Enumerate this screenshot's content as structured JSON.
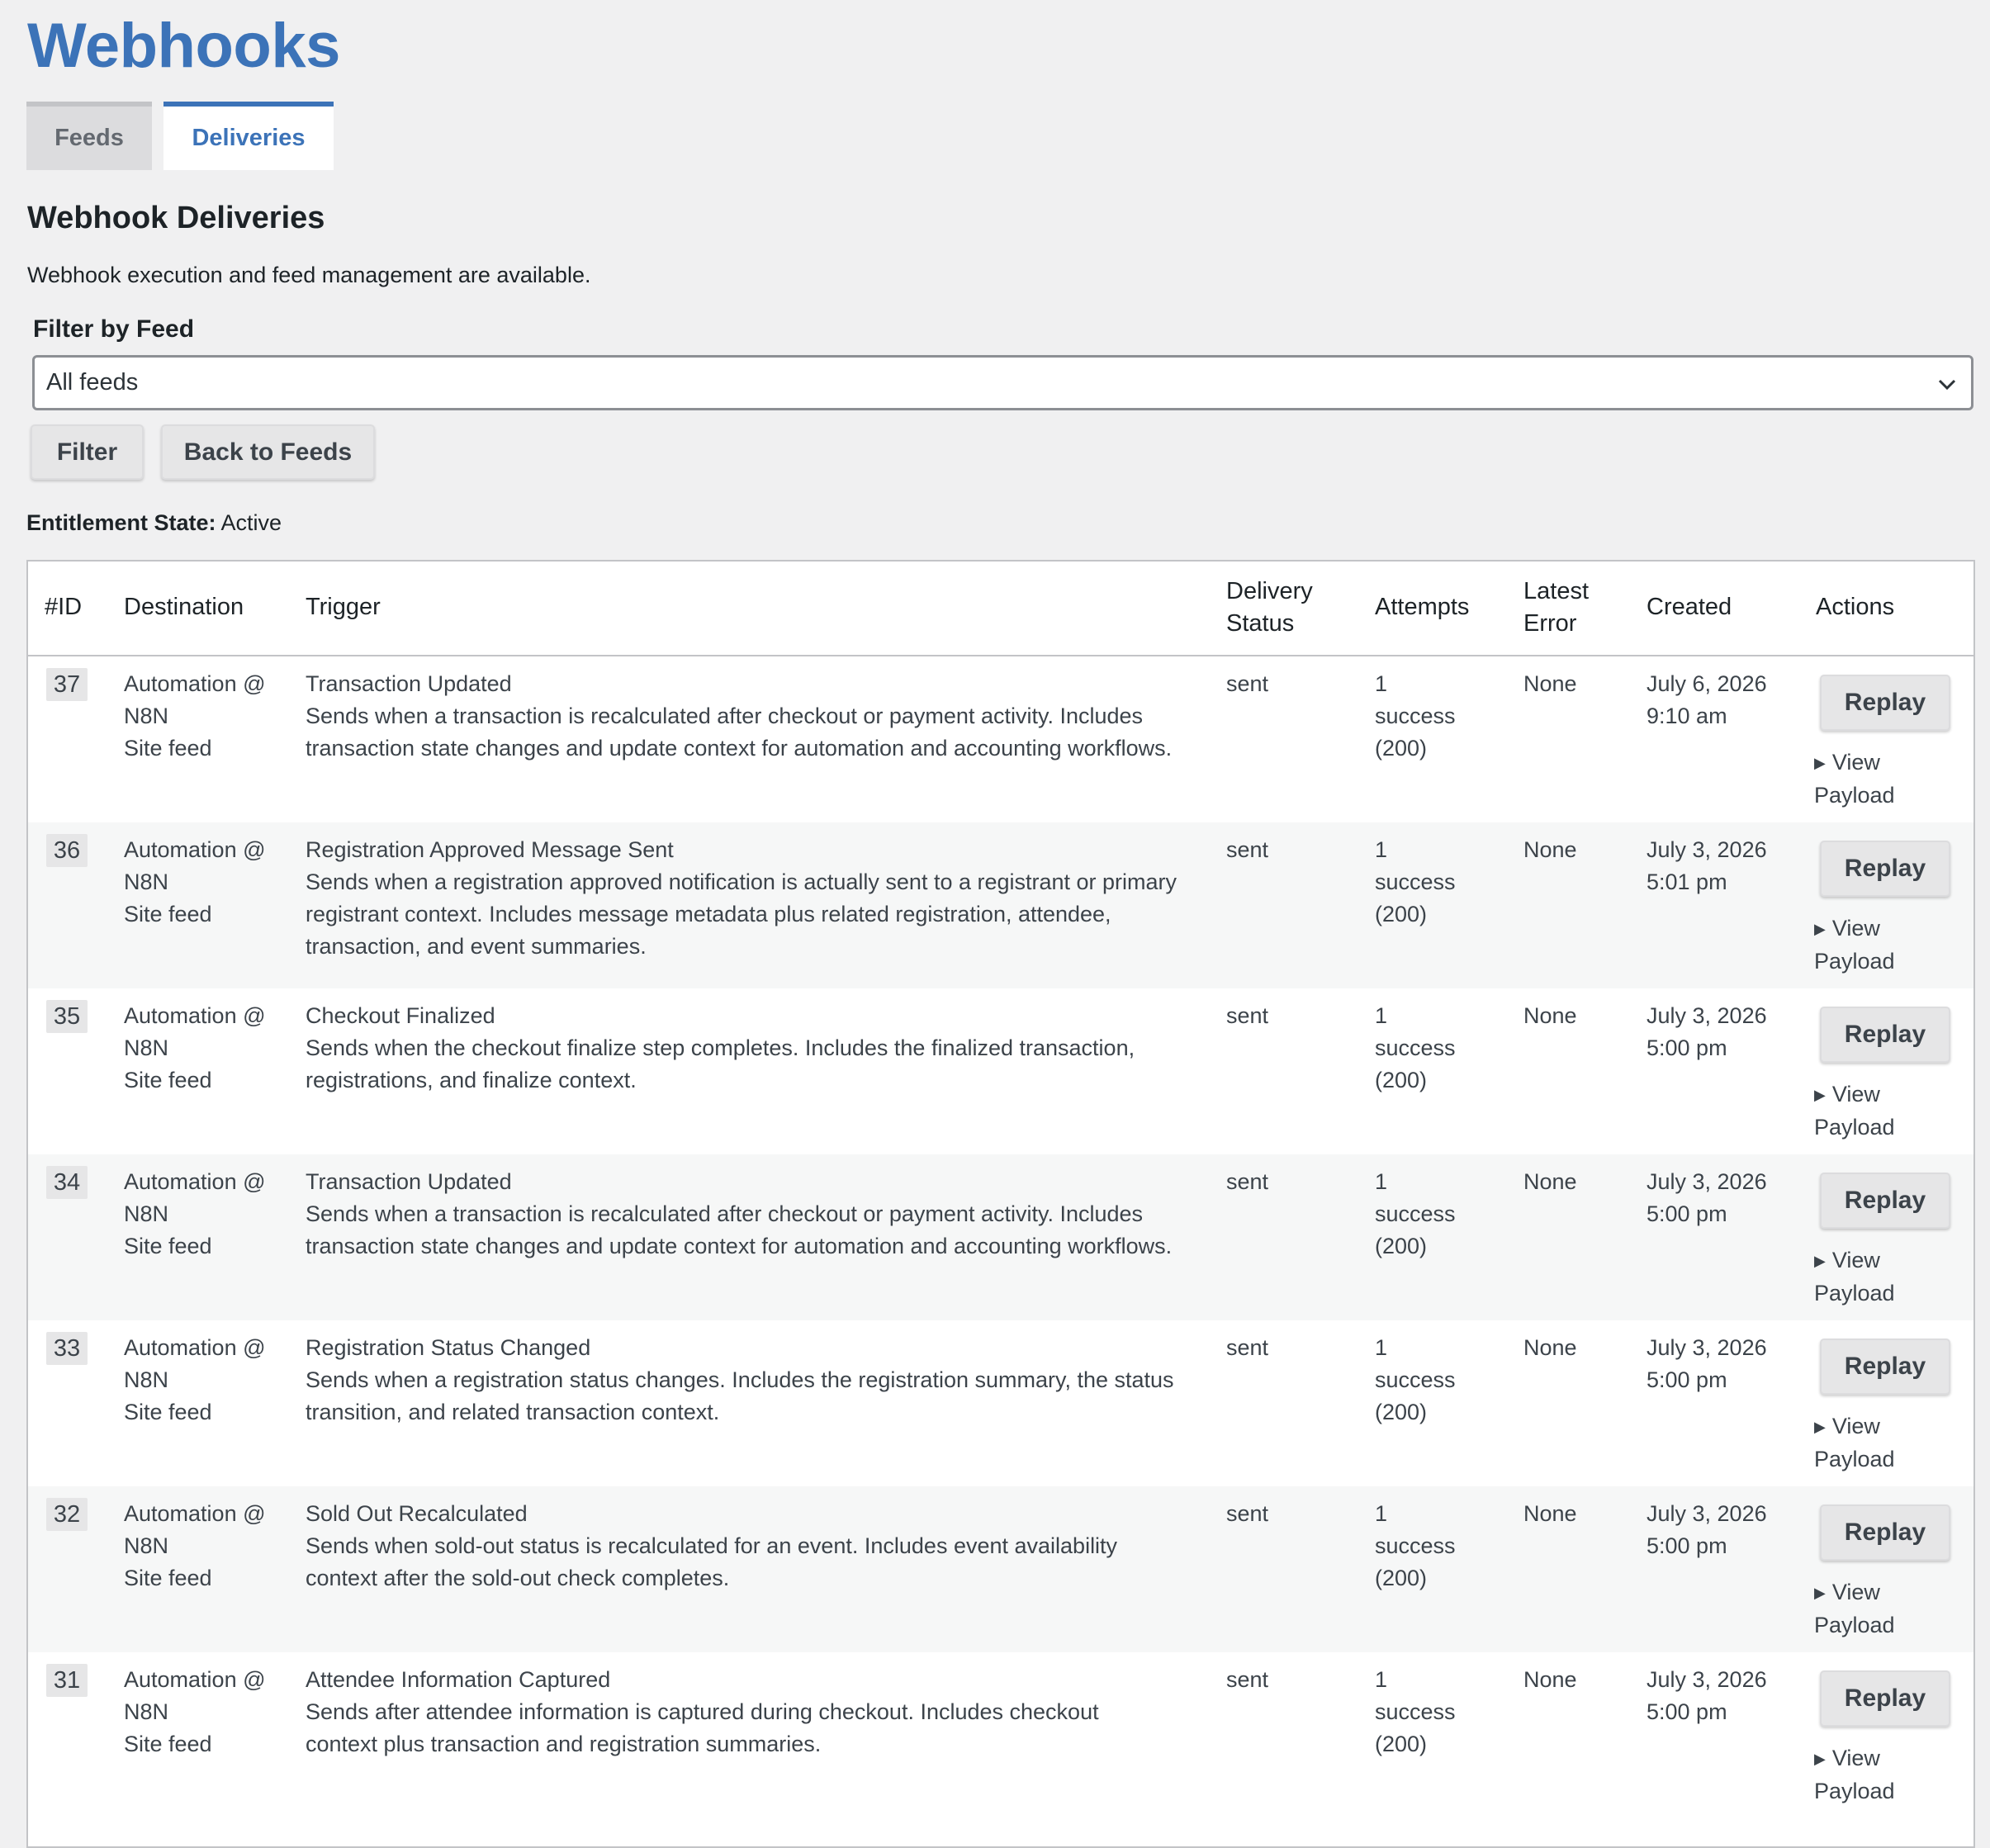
{
  "page": {
    "title": "Webhooks"
  },
  "tabs": [
    {
      "label": "Feeds"
    },
    {
      "label": "Deliveries",
      "active": true
    }
  ],
  "section": {
    "title": "Webhook Deliveries",
    "description": "Webhook execution and feed management are available."
  },
  "filter": {
    "label": "Filter by Feed",
    "selected": "All feeds",
    "filter_button": "Filter",
    "back_button": "Back to Feeds"
  },
  "entitlement": {
    "label": "Entitlement State:",
    "value": "Active"
  },
  "colors": {
    "accent": "#3c73b8",
    "background": "#f0f0f1",
    "row_alt": "#f6f7f7"
  },
  "table": {
    "headers": {
      "id": "#ID",
      "destination": "Destination",
      "trigger": "Trigger",
      "status_line1": "Delivery",
      "status_line2": "Status",
      "attempts": "Attempts",
      "error_line1": "Latest",
      "error_line2": "Error",
      "created": "Created",
      "actions": "Actions"
    },
    "rows": [
      {
        "id": "37",
        "dest_line1": "Automation @",
        "dest_line2": "N8N",
        "dest_line3": "Site feed",
        "trigger_title": "Transaction Updated",
        "trigger_desc_1": "Sends when a transaction is recalculated after checkout or payment activity. Includes",
        "trigger_desc_2": "transaction state changes and update context for automation and accounting workflows.",
        "trigger_desc_3": "",
        "status": "sent",
        "attempts_1": "1",
        "attempts_2": "success",
        "attempts_3": "(200)",
        "error": "None",
        "created_date": "July 6, 2026",
        "created_time": "9:10 am",
        "replay": "Replay",
        "view_1": "View",
        "view_2": "Payload"
      },
      {
        "id": "36",
        "dest_line1": "Automation @",
        "dest_line2": "N8N",
        "dest_line3": "Site feed",
        "trigger_title": "Registration Approved Message Sent",
        "trigger_desc_1": "Sends when a registration approved notification is actually sent to a registrant or primary",
        "trigger_desc_2": "registrant context. Includes message metadata plus related registration, attendee,",
        "trigger_desc_3": "transaction, and event summaries.",
        "status": "sent",
        "attempts_1": "1",
        "attempts_2": "success",
        "attempts_3": "(200)",
        "error": "None",
        "created_date": "July 3, 2026",
        "created_time": "5:01 pm",
        "replay": "Replay",
        "view_1": "View",
        "view_2": "Payload"
      },
      {
        "id": "35",
        "dest_line1": "Automation @",
        "dest_line2": "N8N",
        "dest_line3": "Site feed",
        "trigger_title": "Checkout Finalized",
        "trigger_desc_1": "Sends when the checkout finalize step completes. Includes the finalized transaction,",
        "trigger_desc_2": "registrations, and finalize context.",
        "trigger_desc_3": "",
        "status": "sent",
        "attempts_1": "1",
        "attempts_2": "success",
        "attempts_3": "(200)",
        "error": "None",
        "created_date": "July 3, 2026",
        "created_time": "5:00 pm",
        "replay": "Replay",
        "view_1": "View",
        "view_2": "Payload"
      },
      {
        "id": "34",
        "dest_line1": "Automation @",
        "dest_line2": "N8N",
        "dest_line3": "Site feed",
        "trigger_title": "Transaction Updated",
        "trigger_desc_1": "Sends when a transaction is recalculated after checkout or payment activity. Includes",
        "trigger_desc_2": "transaction state changes and update context for automation and accounting workflows.",
        "trigger_desc_3": "",
        "status": "sent",
        "attempts_1": "1",
        "attempts_2": "success",
        "attempts_3": "(200)",
        "error": "None",
        "created_date": "July 3, 2026",
        "created_time": "5:00 pm",
        "replay": "Replay",
        "view_1": "View",
        "view_2": "Payload"
      },
      {
        "id": "33",
        "dest_line1": "Automation @",
        "dest_line2": "N8N",
        "dest_line3": "Site feed",
        "trigger_title": "Registration Status Changed",
        "trigger_desc_1": "Sends when a registration status changes. Includes the registration summary, the status",
        "trigger_desc_2": "transition, and related transaction context.",
        "trigger_desc_3": "",
        "status": "sent",
        "attempts_1": "1",
        "attempts_2": "success",
        "attempts_3": "(200)",
        "error": "None",
        "created_date": "July 3, 2026",
        "created_time": "5:00 pm",
        "replay": "Replay",
        "view_1": "View",
        "view_2": "Payload"
      },
      {
        "id": "32",
        "dest_line1": "Automation @",
        "dest_line2": "N8N",
        "dest_line3": "Site feed",
        "trigger_title": "Sold Out Recalculated",
        "trigger_desc_1": "Sends when sold-out status is recalculated for an event. Includes event availability",
        "trigger_desc_2": "context after the sold-out check completes.",
        "trigger_desc_3": "",
        "status": "sent",
        "attempts_1": "1",
        "attempts_2": "success",
        "attempts_3": "(200)",
        "error": "None",
        "created_date": "July 3, 2026",
        "created_time": "5:00 pm",
        "replay": "Replay",
        "view_1": "View",
        "view_2": "Payload"
      },
      {
        "id": "31",
        "dest_line1": "Automation @",
        "dest_line2": "N8N",
        "dest_line3": "Site feed",
        "trigger_title": "Attendee Information Captured",
        "trigger_desc_1": "Sends after attendee information is captured during checkout. Includes checkout",
        "trigger_desc_2": "context plus transaction and registration summaries.",
        "trigger_desc_3": "",
        "status": "sent",
        "attempts_1": "1",
        "attempts_2": "success",
        "attempts_3": "(200)",
        "error": "None",
        "created_date": "July 3, 2026",
        "created_time": "5:00 pm",
        "replay": "Replay",
        "view_1": "View",
        "view_2": "Payload"
      }
    ]
  }
}
